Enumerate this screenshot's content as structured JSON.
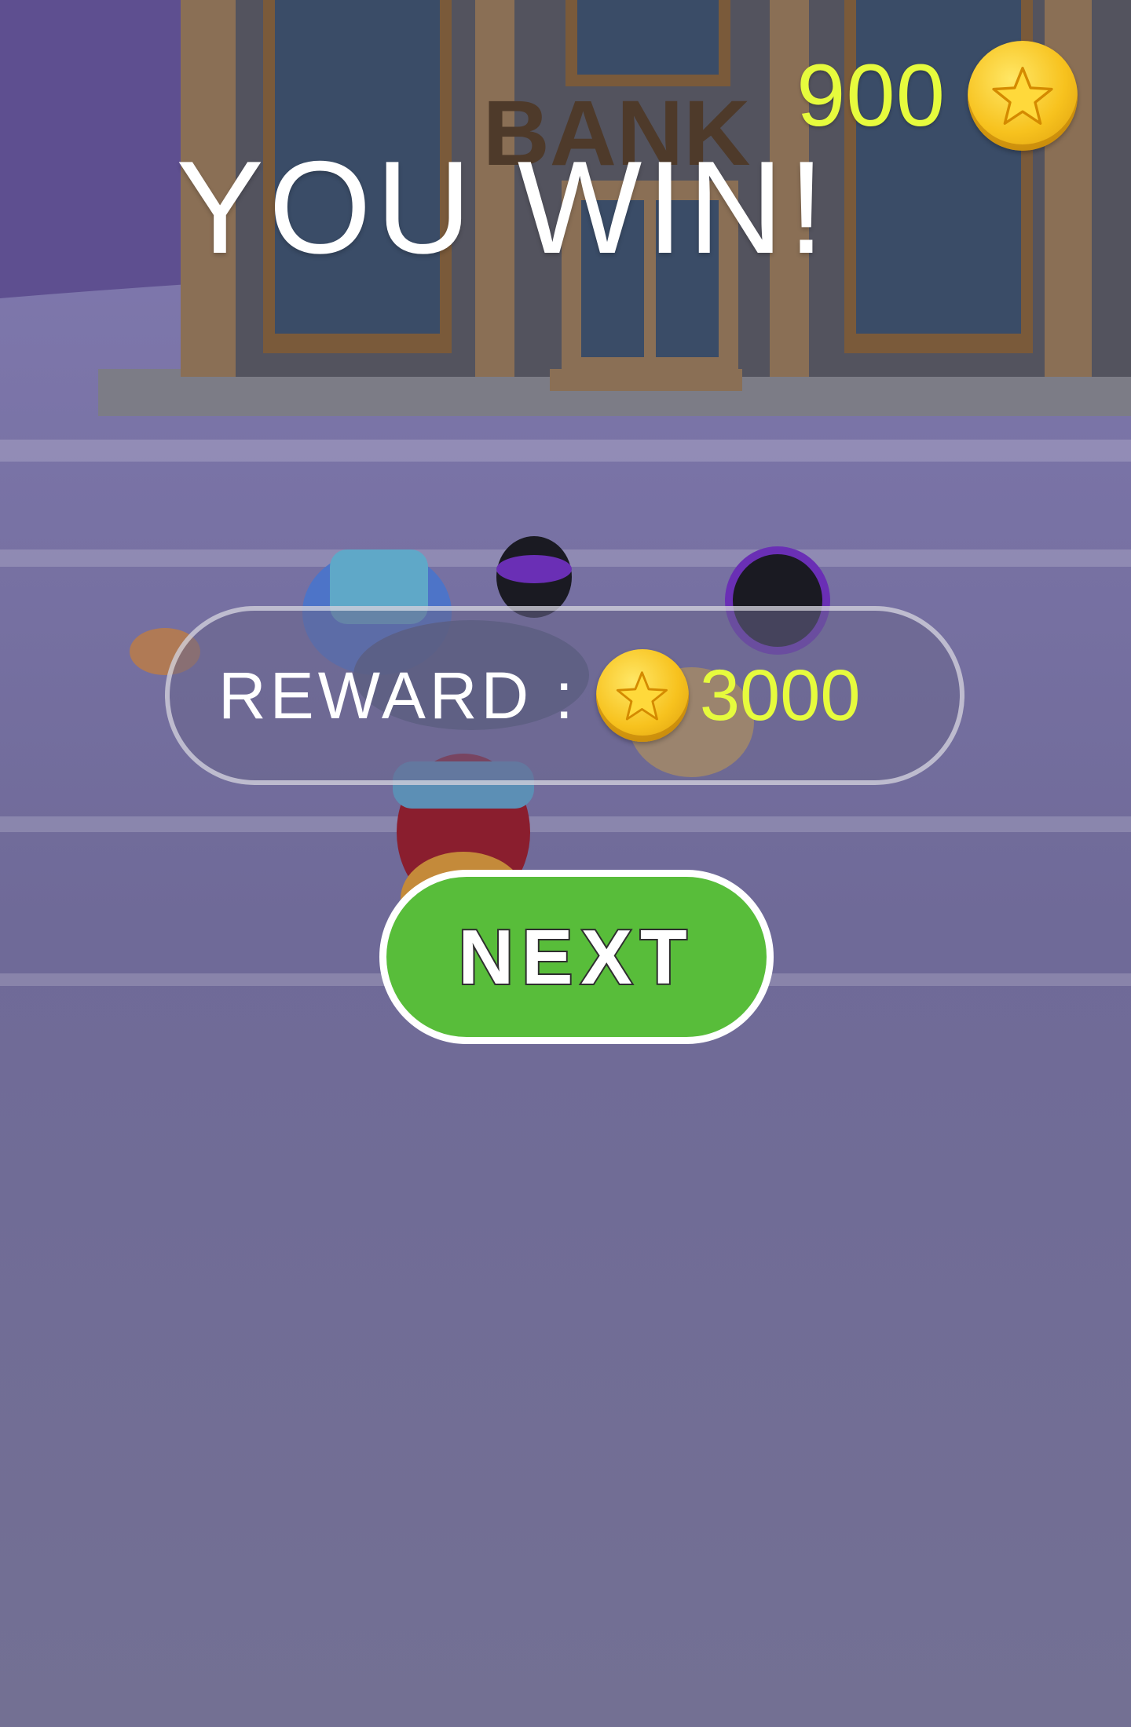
{
  "hud": {
    "coin_count": "900",
    "coin_icon": "star-coin-icon"
  },
  "result": {
    "title": "YOU WIN!"
  },
  "reward": {
    "label": "REWARD :",
    "value": "3000",
    "coin_icon": "star-coin-icon"
  },
  "actions": {
    "next_label": "NEXT"
  },
  "scene": {
    "building_sign": "BANK"
  },
  "colors": {
    "ground": "#726f93",
    "sky": "#5e4f90",
    "coin_text": "#e6fb3d",
    "next_button": "#58bd3a"
  }
}
